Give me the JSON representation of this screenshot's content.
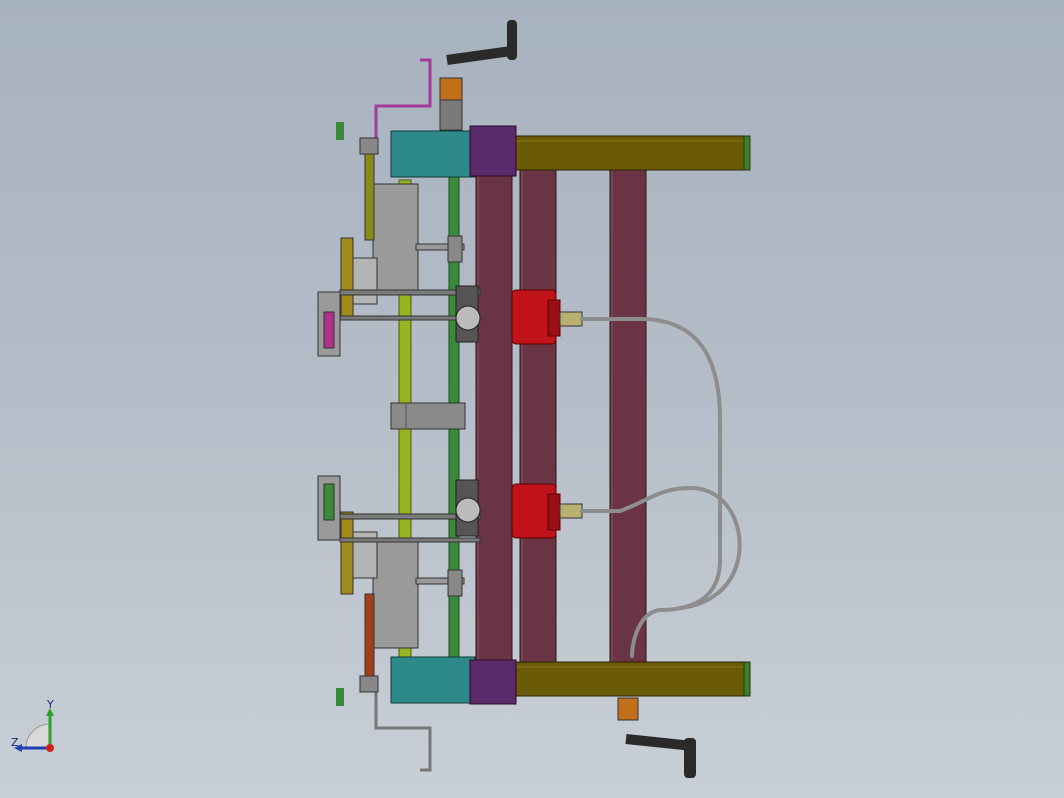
{
  "viewport": {
    "background_top": "#a7b2bf",
    "background_bottom": "#c9cfd6"
  },
  "model": {
    "colors": {
      "frame_beam": "#6b5a08",
      "beam_end": "#3f7f2a",
      "rail": "#6a3444",
      "block": "#2e8a8a",
      "plate": "#9a9a9a",
      "motor": "#c0141a",
      "cable": "#8d8d8d",
      "shaft_yellow": "#9ab320",
      "shaft_green": "#3b8a3b",
      "handle": "#2a2a2a",
      "bracket_orange": "#c0701a",
      "magenta": "#a33a9a"
    }
  },
  "triad": {
    "y_label": "Y",
    "z_label": "Z"
  }
}
